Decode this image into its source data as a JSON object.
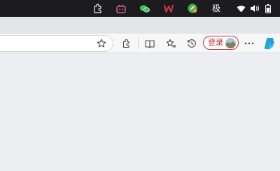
{
  "system_tray": {
    "ime_mode_label": "极",
    "icons": [
      "extension-puzzle-icon",
      "bilibili-icon",
      "wechat-icon",
      "wps-icon",
      "green-app-icon",
      "ime-icon",
      "wifi-icon",
      "volume-icon",
      "battery-icon"
    ]
  },
  "toolbar": {
    "login_label": "登录",
    "icons": [
      "star-icon",
      "extensions-icon",
      "split-screen-icon",
      "favorites-icon",
      "history-icon",
      "more-icon",
      "copilot-icon"
    ]
  },
  "colors": {
    "taskbar_bg": "#1c1c1f",
    "toolbar_bg": "#f7f7f8",
    "content_bg": "#eceef1",
    "login_accent": "#c62e36"
  }
}
